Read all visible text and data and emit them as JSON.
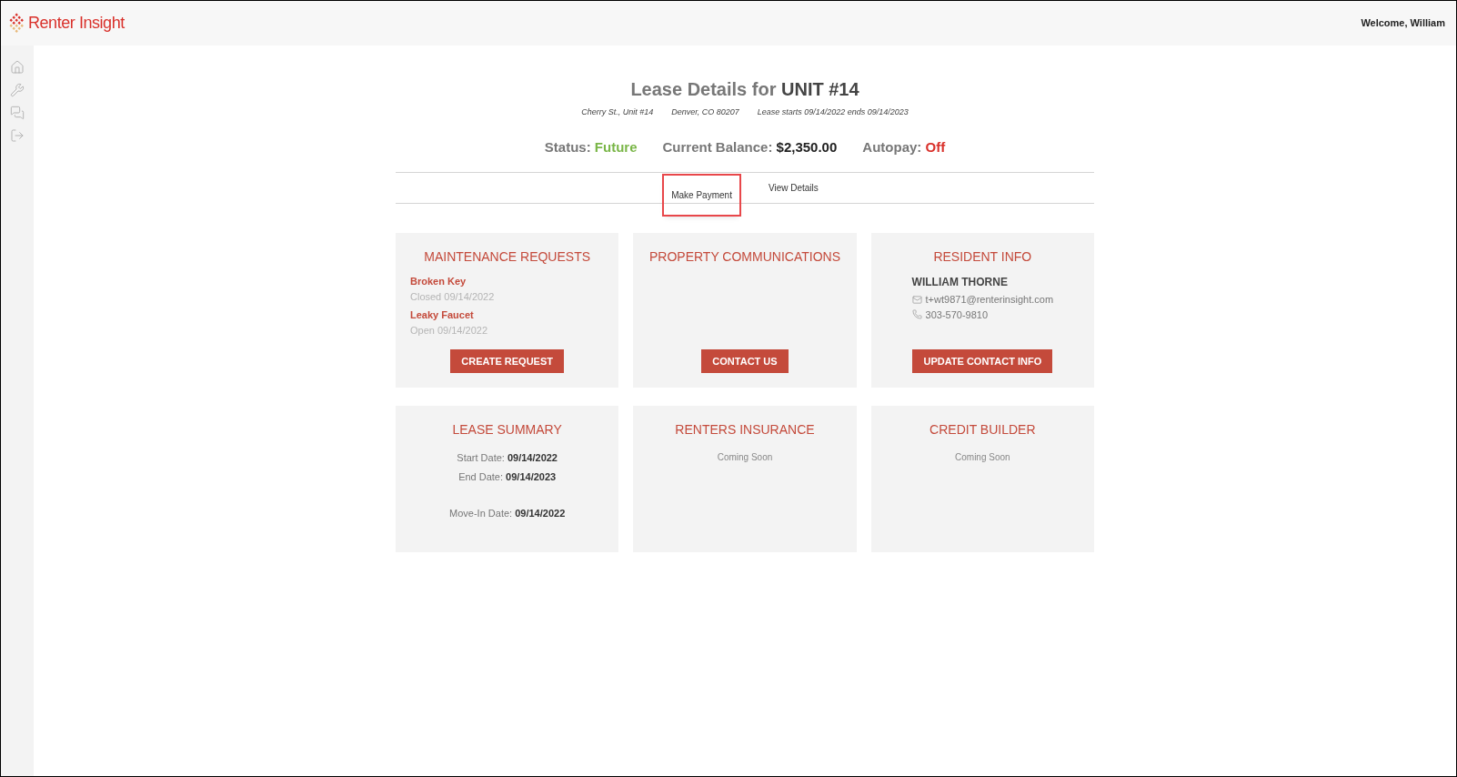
{
  "header": {
    "brand": "Renter Insight",
    "welcome": "Welcome, William"
  },
  "lease": {
    "title_prefix": "Lease Details for",
    "title_unit": "UNIT #14",
    "subtitle": [
      "Cherry St., Unit #14",
      "Denver, CO 80207",
      "Lease starts 09/14/2022 ends 09/14/2023"
    ],
    "stats": [
      {
        "label": "Status:",
        "value": "Future",
        "color": "#7ab648"
      },
      {
        "label": "Current Balance:",
        "value": "$2,350.00",
        "color": "#222222"
      },
      {
        "label": "Autopay:",
        "value": "Off",
        "color": "#d9312b"
      }
    ]
  },
  "actions": [
    {
      "label": "Make Payment",
      "highlighted": true
    },
    {
      "label": "View Details",
      "highlighted": false
    }
  ],
  "cards": [
    {
      "kind": "maintenance",
      "title": "MAINTENANCE REQUESTS",
      "requests": [
        {
          "name": "Broken Key",
          "status": "Closed 09/14/2022"
        },
        {
          "name": "Leaky Faucet",
          "status": "Open 09/14/2022"
        }
      ],
      "button": "CREATE REQUEST"
    },
    {
      "kind": "communications",
      "title": "PROPERTY COMMUNICATIONS",
      "button": "CONTACT US"
    },
    {
      "kind": "resident",
      "title": "RESIDENT INFO",
      "name": "WILLIAM THORNE",
      "email": "t+wt9871@renterinsight.com",
      "phone": "303-570-9810",
      "button": "UPDATE CONTACT INFO"
    },
    {
      "kind": "summary",
      "title": "LEASE SUMMARY",
      "dates": [
        {
          "label": "Start Date:",
          "value": "09/14/2022"
        },
        {
          "label": "End Date:",
          "value": "09/14/2023"
        },
        {
          "label": "Move-In Date:",
          "value": "09/14/2022"
        }
      ]
    },
    {
      "kind": "coming_soon",
      "title": "RENTERS INSURANCE",
      "note": "Coming Soon"
    },
    {
      "kind": "coming_soon",
      "title": "CREDIT BUILDER",
      "note": "Coming Soon"
    }
  ]
}
